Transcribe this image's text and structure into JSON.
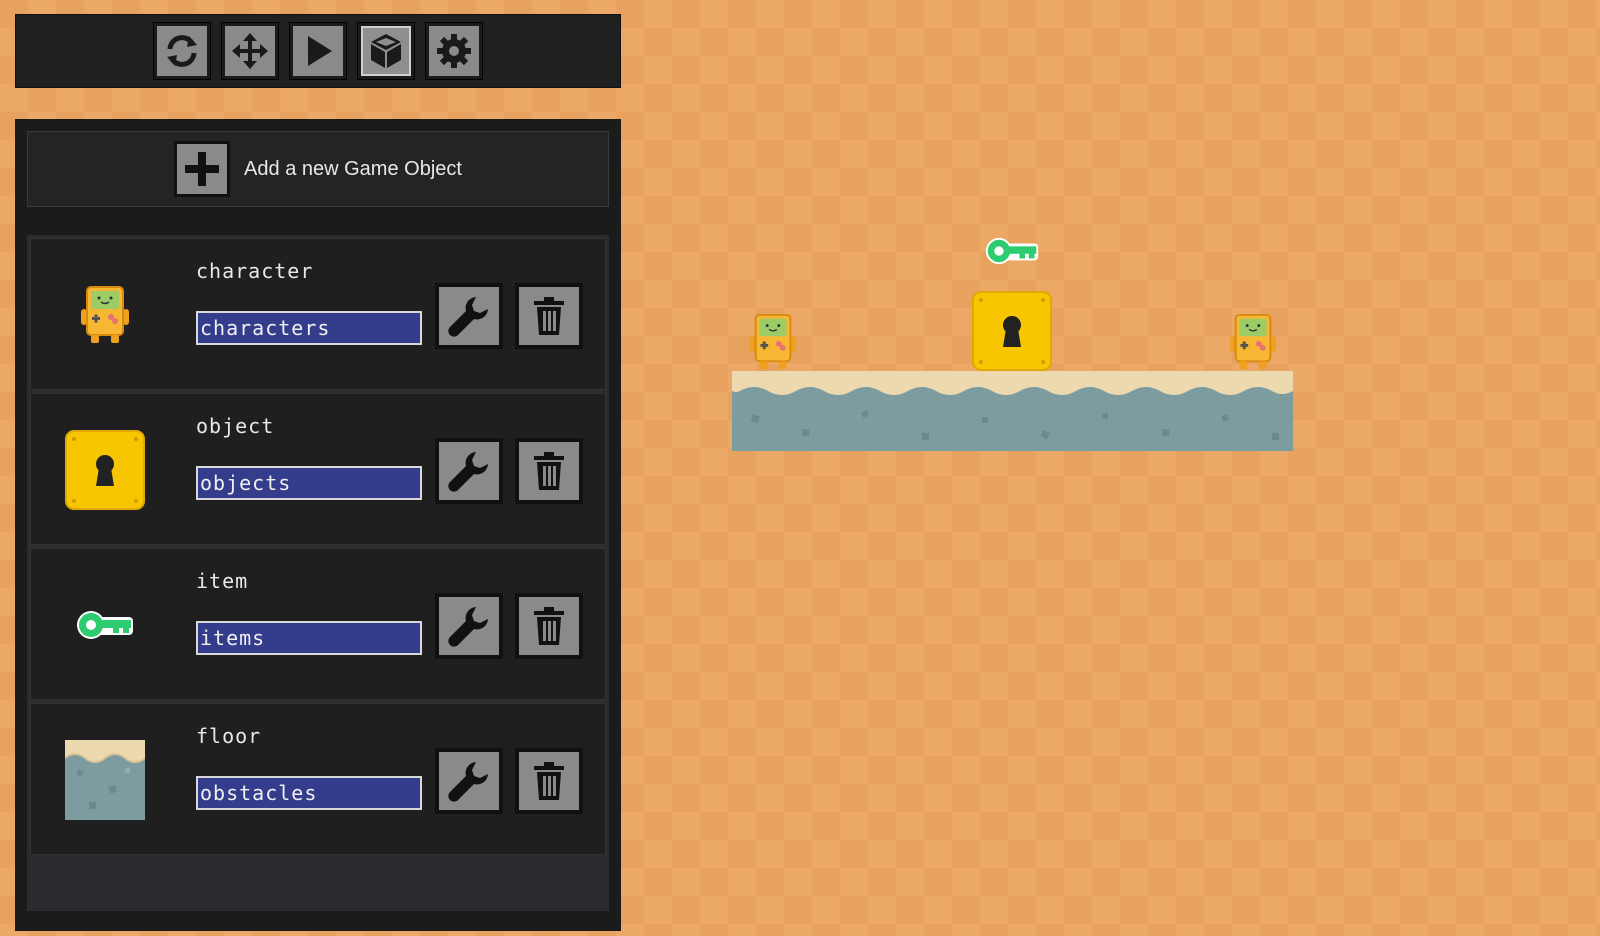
{
  "toolbar": {
    "buttons": [
      {
        "name": "refresh",
        "icon": "refresh-icon",
        "active": false
      },
      {
        "name": "move",
        "icon": "move-arrows-icon",
        "active": false
      },
      {
        "name": "play",
        "icon": "play-icon",
        "active": false
      },
      {
        "name": "objects",
        "icon": "cube-icon",
        "active": true
      },
      {
        "name": "settings",
        "icon": "gear-icon",
        "active": false
      }
    ]
  },
  "panel": {
    "add_label": "Add a new Game Object",
    "add_icon": "plus-icon",
    "objects": [
      {
        "name": "character",
        "group": "characters",
        "thumb": "character-sprite"
      },
      {
        "name": "object",
        "group": "objects",
        "thumb": "lock-block-sprite"
      },
      {
        "name": "item",
        "group": "items",
        "thumb": "key-sprite"
      },
      {
        "name": "floor",
        "group": "obstacles",
        "thumb": "floor-tile-sprite"
      }
    ],
    "edit_icon": "wrench-icon",
    "delete_icon": "trash-icon"
  },
  "scene": {
    "background": "checkered-orange",
    "colors": {
      "orange_a": "#e8a25f",
      "orange_b": "#eba866",
      "key_green": "#2ecc71",
      "lock_yellow": "#f7c600",
      "floor_blue": "#7d9ca0",
      "sand": "#ecd9b0",
      "panel_dark": "#1b1b1b",
      "group_blue": "#333d8c"
    }
  }
}
